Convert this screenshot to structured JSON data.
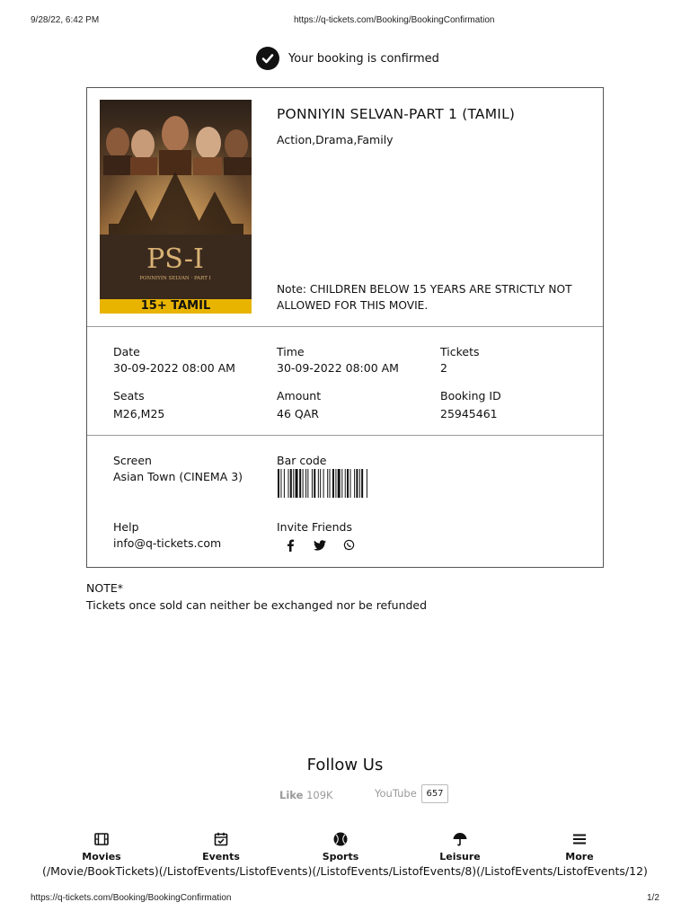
{
  "print_header": {
    "datetime": "9/28/22, 6:42 PM",
    "url": "https://q-tickets.com/Booking/BookingConfirmation"
  },
  "confirmation": {
    "message": "Your booking is confirmed"
  },
  "movie": {
    "title": "PONNIYIN SELVAN-PART 1 (TAMIL)",
    "genres": "Action,Drama,Family",
    "note": "Note: CHILDREN BELOW 15 YEARS ARE STRICTLY NOT ALLOWED FOR THIS MOVIE.",
    "poster": {
      "logo_text": "PS-I",
      "subtitle": "PONNIYIN SELVAN · PART I",
      "band_text": "15+ TAMIL"
    }
  },
  "booking": {
    "date_label": "Date",
    "date_value": "30-09-2022 08:00 AM",
    "time_label": "Time",
    "time_value": "30-09-2022 08:00 AM",
    "tickets_label": "Tickets",
    "tickets_value": "2",
    "seats_label": "Seats",
    "seats_value": "M26,M25",
    "amount_label": "Amount",
    "amount_value": "46 QAR",
    "booking_id_label": "Booking ID",
    "booking_id_value": "25945461",
    "screen_label": "Screen",
    "screen_value": "Asian Town (CINEMA 3)",
    "barcode_label": "Bar code",
    "help_label": "Help",
    "help_value": "info@q-tickets.com",
    "invite_label": "Invite Friends"
  },
  "policy": {
    "title": "NOTE*",
    "text": "Tickets once sold can neither be exchanged nor be refunded"
  },
  "follow": {
    "title": "Follow Us",
    "like_label": "Like",
    "like_count": "109K",
    "youtube_label": "YouTube",
    "youtube_count": "657"
  },
  "bottom_nav": {
    "items": [
      {
        "label": "Movies",
        "icon": "film-icon"
      },
      {
        "label": "Events",
        "icon": "calendar-check-icon"
      },
      {
        "label": "Sports",
        "icon": "ball-icon"
      },
      {
        "label": "Leisure",
        "icon": "umbrella-icon"
      },
      {
        "label": "More",
        "icon": "menu-icon"
      }
    ],
    "links_text": "(/Movie/BookTickets)(/ListofEvents/ListofEvents)(/ListofEvents/ListofEvents/8)(/ListofEvents/ListofEvents/12)"
  },
  "print_footer": {
    "url": "https://q-tickets.com/Booking/BookingConfirmation",
    "page": "1/2"
  }
}
